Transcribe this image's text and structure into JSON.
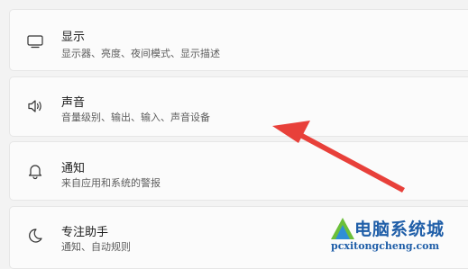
{
  "settings": {
    "items": [
      {
        "icon": "display-icon",
        "title": "显示",
        "subtitle": "显示器、亮度、夜间模式、显示描述"
      },
      {
        "icon": "speaker-icon",
        "title": "声音",
        "subtitle": "音量级别、输出、输入、声音设备"
      },
      {
        "icon": "bell-icon",
        "title": "通知",
        "subtitle": "来自应用和系统的警报"
      },
      {
        "icon": "moon-icon",
        "title": "专注助手",
        "subtitle": "通知、自动规则"
      }
    ]
  },
  "annotation": {
    "arrow_color": "#e8403a"
  },
  "watermark": {
    "cn": "电脑系统城",
    "en": "pcxitongcheng.com"
  }
}
